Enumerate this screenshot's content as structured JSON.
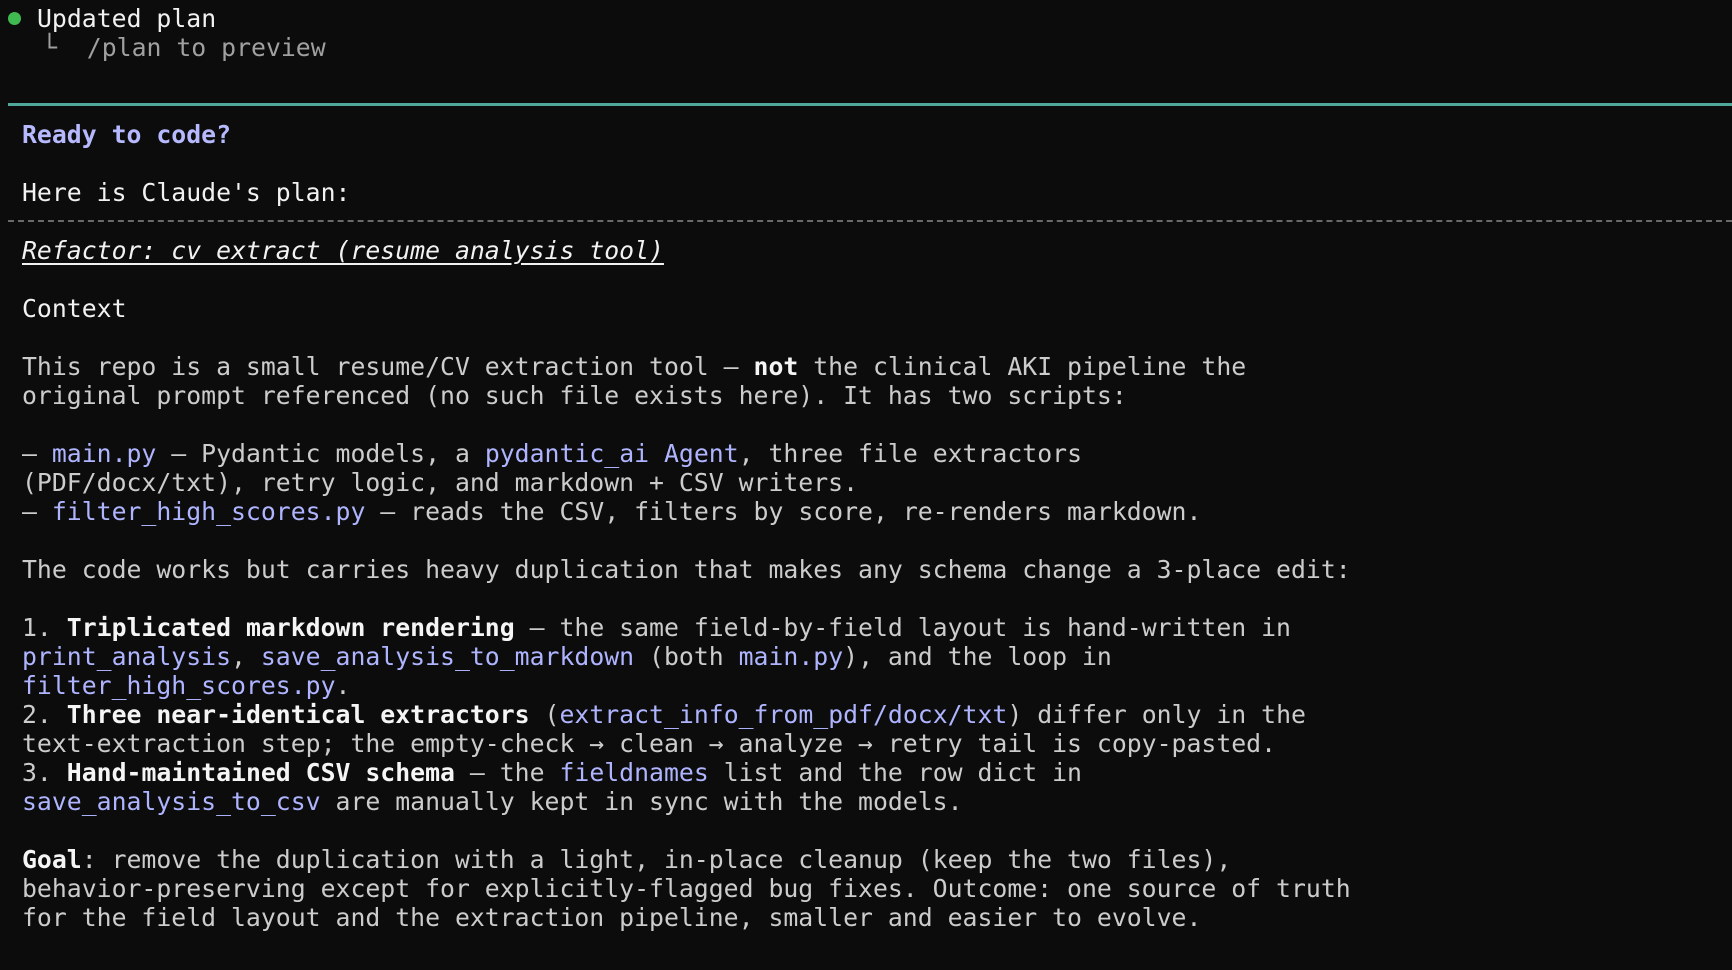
{
  "status": {
    "title": "Updated plan",
    "hint_prefix": "└",
    "hint": "/plan to preview"
  },
  "prompt": {
    "question": "Ready to code?",
    "intro": "Here is Claude's plan:"
  },
  "plan": {
    "title": "Refactor: cv_extract (resume analysis tool)",
    "context_heading": "Context",
    "p1": {
      "a": "This repo is a small resume/CV extraction tool — ",
      "b": "not",
      "c": " the clinical AKI pipeline the",
      "d": "original prompt referenced (no such file exists here). It has two scripts:"
    },
    "scripts": {
      "main_dash": "— ",
      "main_file": "main.py",
      "main_a": " — Pydantic models, a ",
      "main_code": "pydantic_ai Agent",
      "main_b": ", three file extractors",
      "main_c": "(PDF/docx/txt), retry logic, and markdown + CSV writers.",
      "filter_dash": "— ",
      "filter_file": "filter_high_scores.py",
      "filter_a": " — reads the CSV, filters by score, re-renders markdown."
    },
    "p2": "The code works but carries heavy duplication that makes any schema change a 3-place edit:",
    "item1": {
      "num": "1. ",
      "bold": "Triplicated markdown rendering",
      "a": " — the same field-by-field layout is hand-written in",
      "code1": "print_analysis",
      "sep": ", ",
      "code2": "save_analysis_to_markdown",
      "b": " (both ",
      "code3": "main.py",
      "c": "), and the loop in",
      "code4": "filter_high_scores.py",
      "d": "."
    },
    "item2": {
      "num": "2. ",
      "bold": "Three near-identical extractors",
      "a": " (",
      "code1": "extract_info_from_pdf/docx/txt",
      "b": ") differ only in the",
      "c": "text-extraction step; the empty-check → clean → analyze → retry tail is copy-pasted."
    },
    "item3": {
      "num": "3. ",
      "bold": "Hand-maintained CSV schema",
      "a": " — the ",
      "code1": "fieldnames",
      "b": " list and the row dict in",
      "code2": "save_analysis_to_csv",
      "c": " are manually kept in sync with the models."
    },
    "goal": {
      "label": "Goal",
      "a": ": remove the duplication with a light, in-place cleanup (keep the two files),",
      "b": "behavior-preserving except for explicitly-flagged bug fixes. Outcome: one source of truth",
      "c": "for the field layout and the extraction pipeline, smaller and easier to evolve."
    }
  },
  "colors": {
    "background": "#0c0c0c",
    "text": "#cccccc",
    "code": "#afb4ff",
    "status_dot": "#3fb950",
    "rule": "#4fa89a"
  }
}
